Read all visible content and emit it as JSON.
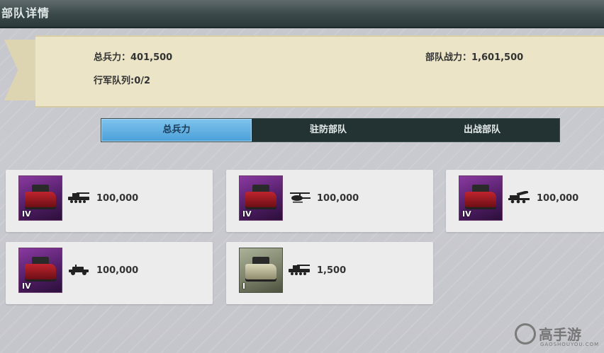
{
  "window": {
    "title": "部队详情"
  },
  "summary": {
    "total_troops_label": "总兵力：401,500",
    "march_queue_label": "行军队列:0/2",
    "troop_power_label": "部队战力：1,601,500"
  },
  "tabs": [
    {
      "label": "总兵力",
      "active": true
    },
    {
      "label": "驻防部队",
      "active": false
    },
    {
      "label": "出战部队",
      "active": false
    }
  ],
  "units": [
    {
      "rank": "IV",
      "type_icon": "tank-icon",
      "count": "100,000",
      "portrait": "purple"
    },
    {
      "rank": "IV",
      "type_icon": "helicopter-icon",
      "count": "100,000",
      "portrait": "purple"
    },
    {
      "rank": "IV",
      "type_icon": "rocket-launcher-icon",
      "count": "100,000",
      "portrait": "purple"
    },
    {
      "rank": "IV",
      "type_icon": "jeep-icon",
      "count": "100,000",
      "portrait": "purple"
    },
    {
      "rank": "I",
      "type_icon": "tank-icon",
      "count": "1,500",
      "portrait": "green"
    }
  ],
  "watermark": {
    "text": "高手游",
    "sub": "GAOSHOUYOU.COM"
  },
  "colors": {
    "active_tab": "#4a9fd8",
    "tab_bar": "#233232",
    "info_panel": "#ebe4c6",
    "portrait_purple": "#6a2a80"
  }
}
